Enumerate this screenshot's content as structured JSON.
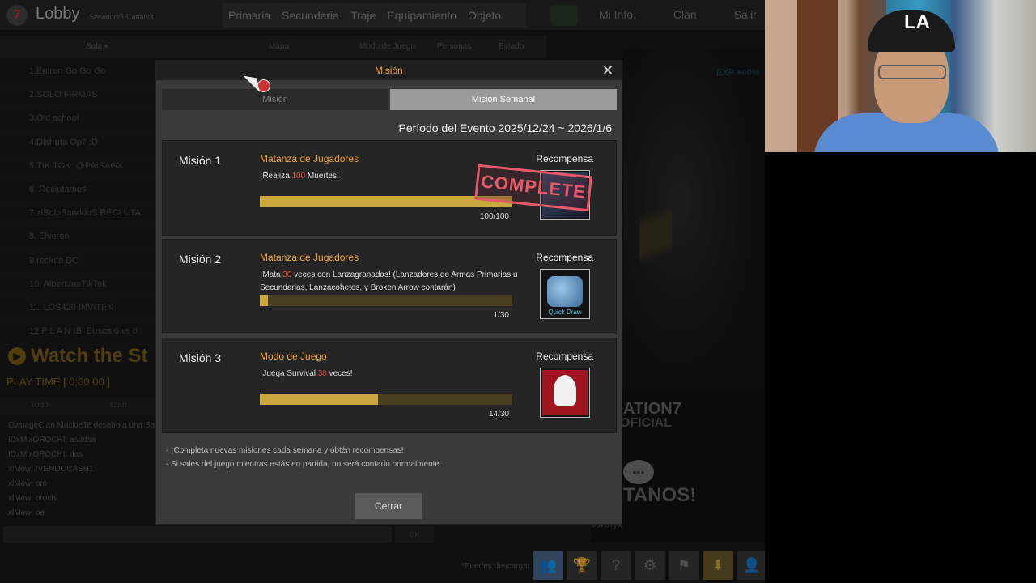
{
  "lobby": {
    "title": "Lobby",
    "server": "Servidor#1/Canal#3",
    "nav": [
      "Primaria",
      "Secundaria",
      "Traje",
      "Equipamiento",
      "Objeto"
    ],
    "nav_right": [
      "Mi Info.",
      "Clan",
      "Salir"
    ],
    "subbar": {
      "sala": "Sala ▾",
      "mapa": "Mapa",
      "modo": "Modo de Juego",
      "personas": "Personas",
      "estado": "Estado"
    },
    "rooms": [
      "1.Entren Go Go Go",
      "2.SOLO FIRMAS",
      "3.Old school",
      "4.Disfruta Op7 :D",
      "5.TIK TOK: @PAISAGX",
      "6.  Reclutamos",
      "7.zlSoloBanddoS RECLUTA",
      "8.    Elveron",
      "9.recluta DC",
      "10.      AlbertJuaTikTok",
      "11.  LOS420    INVITEN",
      "12.P L A N IBI Busca 6 vs 6"
    ],
    "watch": "Watch the St",
    "playtime": "PLAY TIME [ 0:00:00 ]",
    "chat_tabs": [
      "Todo",
      "Clan"
    ],
    "chat": [
      "OwnageClan MackieTe desafío a una Ba",
      "IDxMixOROCHI: asddsa",
      "IDxMixOROCHI: das",
      "xlMow: !VENDOCASH1",
      "xlMow: oro",
      "xlMow: orochi",
      "xlMow: oe"
    ],
    "chat_ok": "OK",
    "hint": "*Puedes descargar",
    "exp": "EXP +40%",
    "banner": {
      "title": "ATION7",
      "sub": "OFICIAL",
      "cta": "TANOS!",
      "user": "s0rtnyx"
    }
  },
  "modal": {
    "title": "Misión",
    "tabs": {
      "mision": "Misión",
      "semanal": "Misión Semanal"
    },
    "period": "Período del Evento 2025/12/24 ~ 2026/1/6",
    "reward_label": "Recompensa",
    "missions": [
      {
        "number": "Misión 1",
        "type": "Matanza de Jugadores",
        "desc_a": "¡Realiza ",
        "desc_hl": "100",
        "desc_b": " Muertes!",
        "progress": 1.0,
        "count": "100/100",
        "stamp": "COMPLETE"
      },
      {
        "number": "Misión 2",
        "type": "Matanza de Jugadores",
        "desc_a": "¡Mata ",
        "desc_hl": "30",
        "desc_b": " veces con Lanzagranadas! (Lanzadores de Armas Primarias u Secundarias, Lanzacohetes, y Broken Arrow contarán)",
        "progress": 0.0333,
        "count": "1/30",
        "reward_caption": "Quick Draw"
      },
      {
        "number": "Misión 3",
        "type": "Modo de Juego",
        "desc_a": "¡Juega Survival ",
        "desc_hl": "30",
        "desc_b": " veces!",
        "progress": 0.4667,
        "count": "14/30"
      }
    ],
    "notes": [
      "- ¡Completa nuevas misiones cada semana y obtén recompensas!",
      "- Si sales del juego mientras estás en partida, no será contado normalmente."
    ],
    "close_button": "Cerrar"
  },
  "webcam": {
    "cap_logo": "LA"
  },
  "colors": {
    "accent": "#e8a33c",
    "highlight": "#e84a3a",
    "progress": "#c9a83e",
    "stamp": "#e45a6a"
  }
}
